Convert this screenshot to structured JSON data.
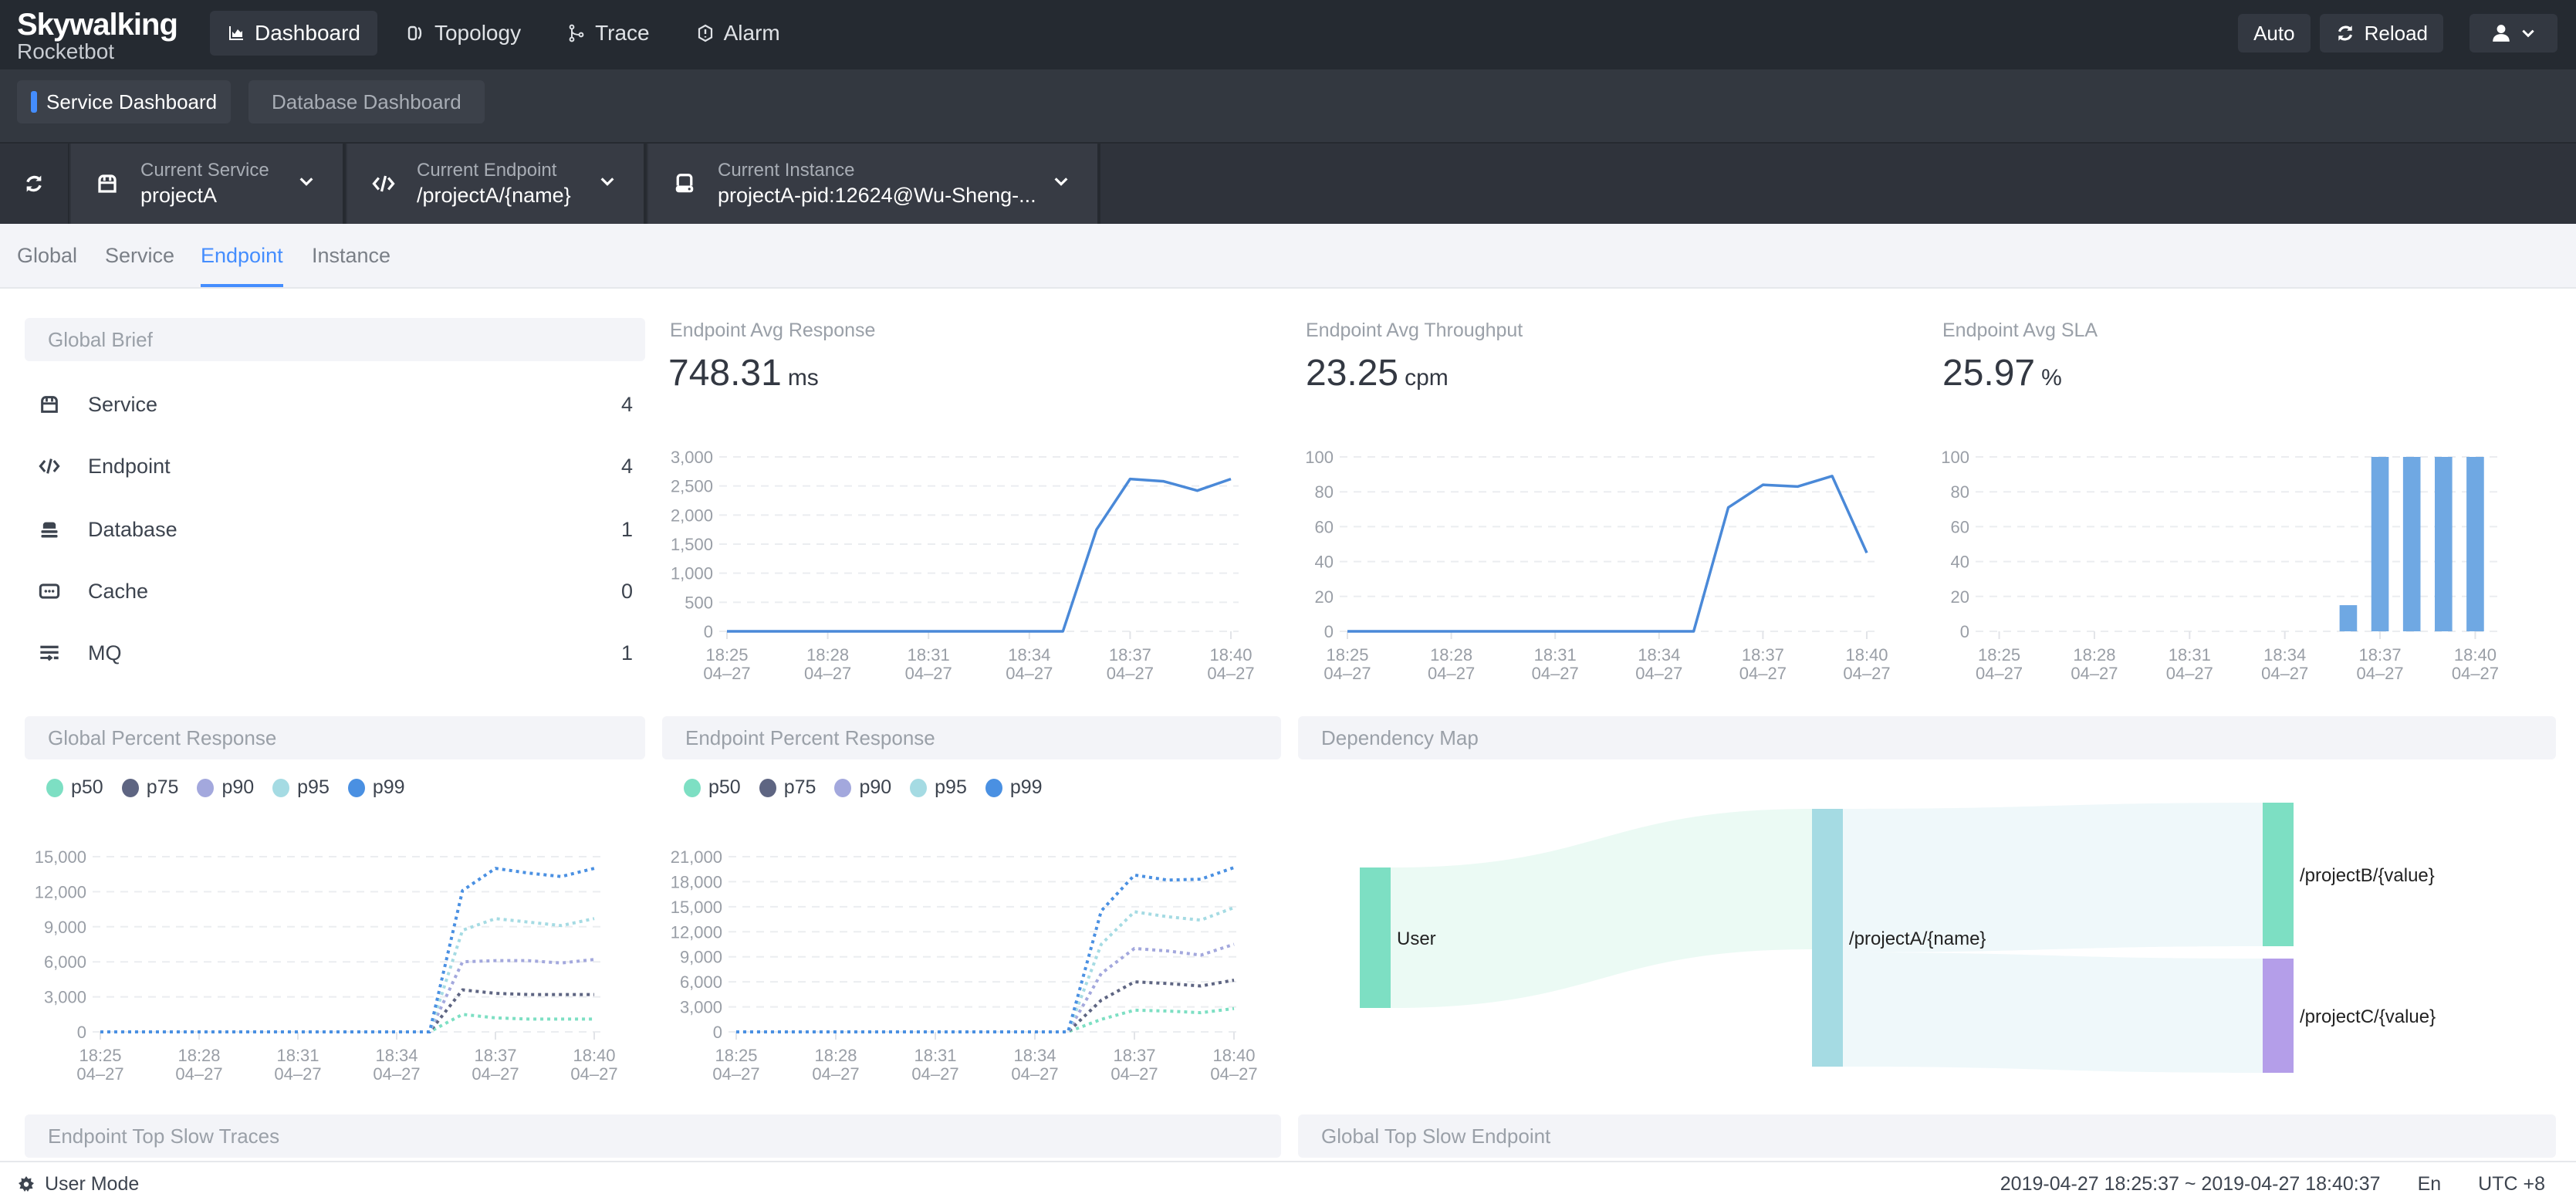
{
  "app": {
    "logo_title": "Skywalking",
    "logo_subtitle": "Rocketbot"
  },
  "nav": [
    {
      "label": "Dashboard",
      "icon": "chart-area-icon",
      "active": true
    },
    {
      "label": "Topology",
      "icon": "topology-icon",
      "active": false
    },
    {
      "label": "Trace",
      "icon": "trace-icon",
      "active": false
    },
    {
      "label": "Alarm",
      "icon": "alarm-icon",
      "active": false
    }
  ],
  "toolbar": {
    "auto_label": "Auto",
    "reload_label": "Reload",
    "user_icon": "user-icon"
  },
  "dashboards": {
    "active": "Service Dashboard",
    "inactive": "Database Dashboard"
  },
  "selectors": {
    "service": {
      "label": "Current Service",
      "value": "projectA"
    },
    "endpoint": {
      "label": "Current Endpoint",
      "value": "/projectA/{name}"
    },
    "instance": {
      "label": "Current Instance",
      "value": "projectA-pid:12624@Wu-Sheng-..."
    }
  },
  "tabs": [
    {
      "label": "Global",
      "active": false
    },
    {
      "label": "Service",
      "active": false
    },
    {
      "label": "Endpoint",
      "active": true
    },
    {
      "label": "Instance",
      "active": false
    }
  ],
  "global_brief": {
    "title": "Global Brief",
    "items": [
      {
        "label": "Service",
        "count": "4",
        "icon": "service-icon"
      },
      {
        "label": "Endpoint",
        "count": "4",
        "icon": "code-icon"
      },
      {
        "label": "Database",
        "count": "1",
        "icon": "database-icon"
      },
      {
        "label": "Cache",
        "count": "0",
        "icon": "cache-icon"
      },
      {
        "label": "MQ",
        "count": "1",
        "icon": "mq-icon"
      }
    ]
  },
  "metrics": {
    "response": {
      "title": "Endpoint Avg Response",
      "value": "748.31",
      "unit": "ms"
    },
    "throughput": {
      "title": "Endpoint Avg Throughput",
      "value": "23.25",
      "unit": "cpm"
    },
    "sla": {
      "title": "Endpoint Avg SLA",
      "value": "25.97",
      "unit": "%"
    }
  },
  "panels": {
    "global_percent": "Global Percent Response",
    "endpoint_percent": "Endpoint Percent Response",
    "dependency_map": "Dependency Map",
    "top_slow_traces": "Endpoint Top Slow Traces",
    "global_top_slow": "Global Top Slow Endpoint"
  },
  "legend": [
    {
      "name": "p50",
      "color": "#7ddfc3"
    },
    {
      "name": "p75",
      "color": "#5e6582"
    },
    {
      "name": "p90",
      "color": "#a3a8dd"
    },
    {
      "name": "p95",
      "color": "#a5dbe3"
    },
    {
      "name": "p99",
      "color": "#4a90e2"
    }
  ],
  "chart_data": [
    {
      "id": "avg-response",
      "type": "line",
      "title": "Endpoint Avg Response",
      "x": [
        "18:25",
        "18:26",
        "18:27",
        "18:28",
        "18:29",
        "18:30",
        "18:31",
        "18:32",
        "18:33",
        "18:34",
        "18:35",
        "18:36",
        "18:37",
        "18:38",
        "18:39",
        "18:40"
      ],
      "x_tick_labels": [
        [
          "18:25",
          "04-27"
        ],
        [
          "18:28",
          "04-27"
        ],
        [
          "18:31",
          "04-27"
        ],
        [
          "18:34",
          "04-27"
        ],
        [
          "18:37",
          "04-27"
        ],
        [
          "18:40",
          "04-27"
        ]
      ],
      "y_ticks": [
        0,
        500,
        1000,
        1500,
        2000,
        2500,
        3000
      ],
      "ylim": [
        0,
        3000
      ],
      "grid": true,
      "series": [
        {
          "name": "avg response",
          "color": "#4a89d8",
          "values": [
            0,
            0,
            0,
            0,
            0,
            0,
            0,
            0,
            0,
            0,
            0,
            1750,
            2620,
            2580,
            2420,
            2620
          ]
        }
      ]
    },
    {
      "id": "avg-throughput",
      "type": "line",
      "title": "Endpoint Avg Throughput",
      "x": [
        "18:25",
        "18:26",
        "18:27",
        "18:28",
        "18:29",
        "18:30",
        "18:31",
        "18:32",
        "18:33",
        "18:34",
        "18:35",
        "18:36",
        "18:37",
        "18:38",
        "18:39",
        "18:40"
      ],
      "x_tick_labels": [
        [
          "18:25",
          "04-27"
        ],
        [
          "18:28",
          "04-27"
        ],
        [
          "18:31",
          "04-27"
        ],
        [
          "18:34",
          "04-27"
        ],
        [
          "18:37",
          "04-27"
        ],
        [
          "18:40",
          "04-27"
        ]
      ],
      "y_ticks": [
        0,
        20,
        40,
        60,
        80,
        100
      ],
      "ylim": [
        0,
        100
      ],
      "grid": true,
      "series": [
        {
          "name": "throughput",
          "color": "#4a89d8",
          "values": [
            0,
            0,
            0,
            0,
            0,
            0,
            0,
            0,
            0,
            0,
            0,
            71,
            84,
            83,
            89,
            45
          ]
        }
      ]
    },
    {
      "id": "avg-sla",
      "type": "bar",
      "title": "Endpoint Avg SLA",
      "x": [
        "18:25",
        "18:26",
        "18:27",
        "18:28",
        "18:29",
        "18:30",
        "18:31",
        "18:32",
        "18:33",
        "18:34",
        "18:35",
        "18:36",
        "18:37",
        "18:38",
        "18:39",
        "18:40"
      ],
      "x_tick_labels": [
        [
          "18:25",
          "04-27"
        ],
        [
          "18:28",
          "04-27"
        ],
        [
          "18:31",
          "04-27"
        ],
        [
          "18:34",
          "04-27"
        ],
        [
          "18:37",
          "04-27"
        ],
        [
          "18:40",
          "04-27"
        ]
      ],
      "y_ticks": [
        0,
        20,
        40,
        60,
        80,
        100
      ],
      "ylim": [
        0,
        100
      ],
      "grid": true,
      "series": [
        {
          "name": "sla",
          "color": "#6fa8e3",
          "values": [
            0,
            0,
            0,
            0,
            0,
            0,
            0,
            0,
            0,
            0,
            0,
            15,
            100,
            100,
            100,
            100
          ]
        }
      ]
    },
    {
      "id": "global-percent",
      "type": "line",
      "title": "Global Percent Response",
      "x": [
        "18:25",
        "18:26",
        "18:27",
        "18:28",
        "18:29",
        "18:30",
        "18:31",
        "18:32",
        "18:33",
        "18:34",
        "18:35",
        "18:36",
        "18:37",
        "18:38",
        "18:39",
        "18:40"
      ],
      "x_tick_labels": [
        [
          "18:25",
          "04-27"
        ],
        [
          "18:28",
          "04-27"
        ],
        [
          "18:31",
          "04-27"
        ],
        [
          "18:34",
          "04-27"
        ],
        [
          "18:37",
          "04-27"
        ],
        [
          "18:40",
          "04-27"
        ]
      ],
      "y_ticks": [
        0,
        3000,
        6000,
        9000,
        12000,
        15000
      ],
      "ylim": [
        0,
        15000
      ],
      "grid": true,
      "legend": "top-left",
      "series": [
        {
          "name": "p50",
          "color": "#7ddfc3",
          "values": [
            0,
            0,
            0,
            0,
            0,
            0,
            0,
            0,
            0,
            0,
            0,
            1500,
            1200,
            1100,
            1100,
            1100
          ]
        },
        {
          "name": "p75",
          "color": "#5e6582",
          "values": [
            0,
            0,
            0,
            0,
            0,
            0,
            0,
            0,
            0,
            0,
            0,
            3600,
            3300,
            3200,
            3200,
            3200
          ]
        },
        {
          "name": "p90",
          "color": "#a3a8dd",
          "values": [
            0,
            0,
            0,
            0,
            0,
            0,
            0,
            0,
            0,
            0,
            0,
            6000,
            6100,
            6100,
            5900,
            6200
          ]
        },
        {
          "name": "p95",
          "color": "#a5dbe3",
          "values": [
            0,
            0,
            0,
            0,
            0,
            0,
            0,
            0,
            0,
            0,
            0,
            8700,
            9700,
            9400,
            9100,
            9700
          ]
        },
        {
          "name": "p99",
          "color": "#4a90e2",
          "values": [
            0,
            0,
            0,
            0,
            0,
            0,
            0,
            0,
            0,
            0,
            0,
            12100,
            14000,
            13600,
            13300,
            14000
          ]
        }
      ]
    },
    {
      "id": "endpoint-percent",
      "type": "line",
      "title": "Endpoint Percent Response",
      "x": [
        "18:25",
        "18:26",
        "18:27",
        "18:28",
        "18:29",
        "18:30",
        "18:31",
        "18:32",
        "18:33",
        "18:34",
        "18:35",
        "18:36",
        "18:37",
        "18:38",
        "18:39",
        "18:40"
      ],
      "x_tick_labels": [
        [
          "18:25",
          "04-27"
        ],
        [
          "18:28",
          "04-27"
        ],
        [
          "18:31",
          "04-27"
        ],
        [
          "18:34",
          "04-27"
        ],
        [
          "18:37",
          "04-27"
        ],
        [
          "18:40",
          "04-27"
        ]
      ],
      "y_ticks": [
        0,
        3000,
        6000,
        9000,
        12000,
        15000,
        18000,
        21000
      ],
      "ylim": [
        0,
        21000
      ],
      "grid": true,
      "legend": "top-left",
      "series": [
        {
          "name": "p50",
          "color": "#7ddfc3",
          "values": [
            0,
            0,
            0,
            0,
            0,
            0,
            0,
            0,
            0,
            0,
            0,
            1500,
            2600,
            2500,
            2300,
            2800
          ]
        },
        {
          "name": "p75",
          "color": "#5e6582",
          "values": [
            0,
            0,
            0,
            0,
            0,
            0,
            0,
            0,
            0,
            0,
            0,
            3800,
            6000,
            5800,
            5500,
            6200
          ]
        },
        {
          "name": "p90",
          "color": "#a3a8dd",
          "values": [
            0,
            0,
            0,
            0,
            0,
            0,
            0,
            0,
            0,
            0,
            0,
            7000,
            10000,
            9700,
            9200,
            10500
          ]
        },
        {
          "name": "p95",
          "color": "#a5dbe3",
          "values": [
            0,
            0,
            0,
            0,
            0,
            0,
            0,
            0,
            0,
            0,
            0,
            10500,
            14400,
            13800,
            13400,
            14900
          ]
        },
        {
          "name": "p99",
          "color": "#4a90e2",
          "values": [
            0,
            0,
            0,
            0,
            0,
            0,
            0,
            0,
            0,
            0,
            0,
            14500,
            18800,
            18200,
            18300,
            19700
          ]
        }
      ]
    },
    {
      "id": "dependency-map",
      "type": "sankey",
      "title": "Dependency Map",
      "nodes": [
        {
          "name": "User",
          "color": "#7ddfc3"
        },
        {
          "name": "/projectA/{name}",
          "color": "#a5dbe3"
        },
        {
          "name": "/projectB/{value}",
          "color": "#7ddfc3"
        },
        {
          "name": "/projectC/{value}",
          "color": "#b49ee9"
        }
      ],
      "links": [
        {
          "source": "User",
          "target": "/projectA/{name}",
          "value": 1
        },
        {
          "source": "/projectA/{name}",
          "target": "/projectB/{value}",
          "value": 1
        },
        {
          "source": "/projectA/{name}",
          "target": "/projectC/{value}",
          "value": 0.8
        }
      ]
    }
  ],
  "footer": {
    "mode_label": "User Mode",
    "time_range": "2019-04-27 18:25:37 ~ 2019-04-27 18:40:37",
    "language": "En",
    "timezone": "UTC +8"
  }
}
